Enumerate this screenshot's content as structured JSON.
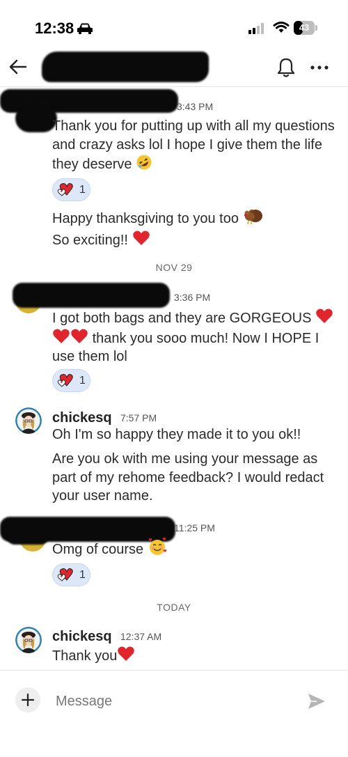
{
  "status_bar": {
    "time": "12:38",
    "battery": "43",
    "battery_level": 0.43
  },
  "header": {
    "title": ""
  },
  "messages": [
    {
      "time": "3:43 PM",
      "text": "Thank you for putting up with all my questions and crazy asks lol I hope I give them the life they deserve",
      "emoji": "rolling-on-floor-laughing-emoji",
      "reaction_count": "1"
    },
    {
      "text": "Happy thanksgiving to you too",
      "emoji": "turkey-emoji"
    },
    {
      "text": "So exciting!!",
      "emoji": "red-heart-emoji"
    },
    {
      "time": "3:36 PM",
      "text": "I got both bags and they are GORGEOUS",
      "text_after": "thank you sooo much! Now I HOPE I use them lol",
      "emoji": "red-heart-emoji x3",
      "reaction_count": "1"
    },
    {
      "author": "chickesq",
      "time": "7:57 PM",
      "text": "Oh I'm so happy they made it to you ok!!"
    },
    {
      "text": "Are you ok with me using your message as part of my rehome feedback? I would redact your user name."
    },
    {
      "time": "11:25 PM",
      "text": "Omg of course",
      "emoji": "smiling-face-with-hearts-emoji",
      "reaction_count": "1"
    },
    {
      "author": "chickesq",
      "time": "12:37 AM",
      "text": "Thank you",
      "emoji": "red-heart-emoji"
    }
  ],
  "separators": {
    "nov": "NOV 29",
    "today": "TODAY"
  },
  "composer": {
    "placeholder": "Message"
  },
  "colors": {
    "reaction_bg": "#dce8f8",
    "heart": "#e0252c",
    "separator_text": "#666666"
  }
}
